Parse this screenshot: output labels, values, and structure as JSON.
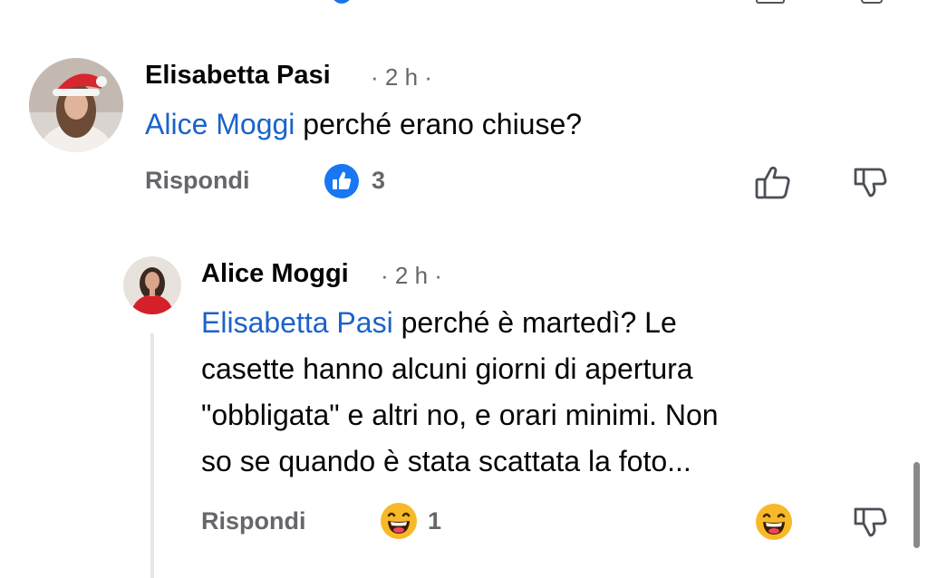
{
  "comments": [
    {
      "author": "Elisabetta Pasi",
      "meta": "· 2 h ·",
      "mention": "Alice Moggi",
      "text": " perché erano chiuse?",
      "reply_label": "Rispondi",
      "reaction_icon": "like-icon",
      "reaction_count": "3"
    },
    {
      "author": "Alice Moggi",
      "meta": "· 2 h ·",
      "mention": "Elisabetta Pasi",
      "lines": [
        " perché è martedì? Le",
        "casette hanno alcuni giorni di apertura",
        "\"obbligata\" e altri no, e orari minimi. Non",
        "so se quando è stata scattata la foto..."
      ],
      "reply_label": "Rispondi",
      "reaction_icon": "laughing-emoji-icon",
      "reaction_count": "1"
    }
  ],
  "colors": {
    "mention": "#1b63c9",
    "like_blue": "#1877f2",
    "laugh_yellow": "#f7b928",
    "meta_gray": "#65676b"
  }
}
